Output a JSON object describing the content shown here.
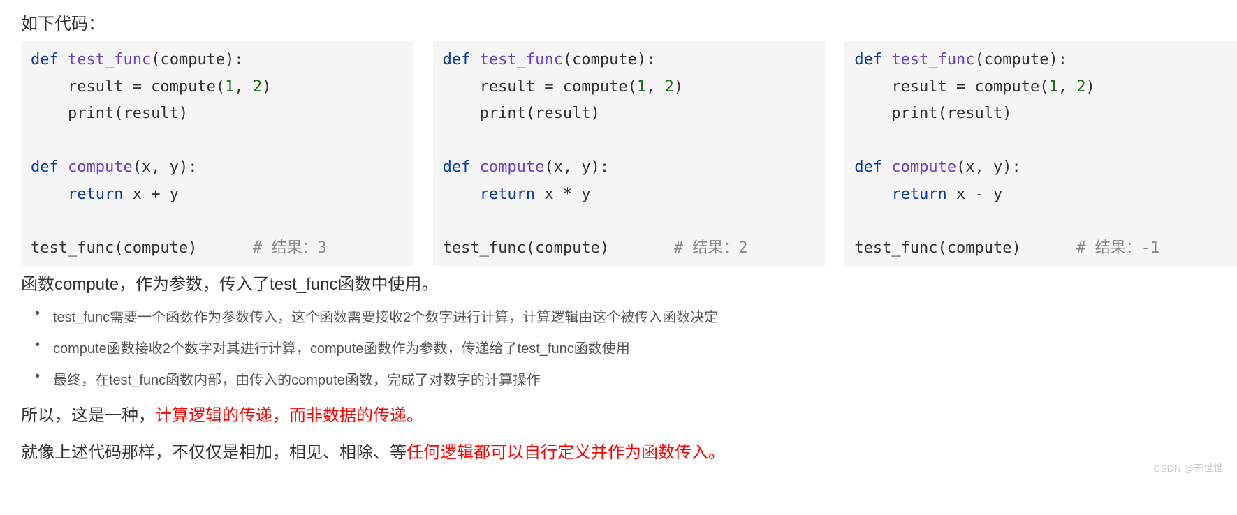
{
  "intro": "如下代码：",
  "code_examples": [
    {
      "test_func_def": "def test_func(compute):",
      "result_line": "    result = compute(1, 2)",
      "print_line": "    print(result)",
      "compute_def": "def compute(x, y):",
      "return_line_prefix": "    return x ",
      "operator": "+",
      "return_line_suffix": " y",
      "call_line": "test_func(compute)",
      "comment_padding": "      ",
      "comment": "# 结果：3"
    },
    {
      "test_func_def": "def test_func(compute):",
      "result_line": "    result = compute(1, 2)",
      "print_line": "    print(result)",
      "compute_def": "def compute(x, y):",
      "return_line_prefix": "    return x ",
      "operator": "*",
      "return_line_suffix": " y",
      "call_line": "test_func(compute)",
      "comment_padding": "       ",
      "comment": "# 结果：2"
    },
    {
      "test_func_def": "def test_func(compute):",
      "result_line": "    result = compute(1, 2)",
      "print_line": "    print(result)",
      "compute_def": "def compute(x, y):",
      "return_line_prefix": "    return x ",
      "operator": "-",
      "return_line_suffix": " y",
      "call_line": "test_func(compute)",
      "comment_padding": "      ",
      "comment": "# 结果：-1"
    }
  ],
  "summary": "函数compute，作为参数，传入了test_func函数中使用。",
  "bullets": [
    "test_func需要一个函数作为参数传入，这个函数需要接收2个数字进行计算，计算逻辑由这个被传入函数决定",
    "compute函数接收2个数字对其进行计算，compute函数作为参数，传递给了test_func函数使用",
    "最终，在test_func函数内部，由传入的compute函数，完成了对数字的计算操作"
  ],
  "conclusion1_black": "所以，这是一种，",
  "conclusion1_red": "计算逻辑的传递，而非数据的传递。",
  "conclusion2_black": "就像上述代码那样，不仅仅是相加，相见、相除、等",
  "conclusion2_red": "任何逻辑都可以自行定义并作为函数传入。",
  "watermark": "CSDN @无世世"
}
